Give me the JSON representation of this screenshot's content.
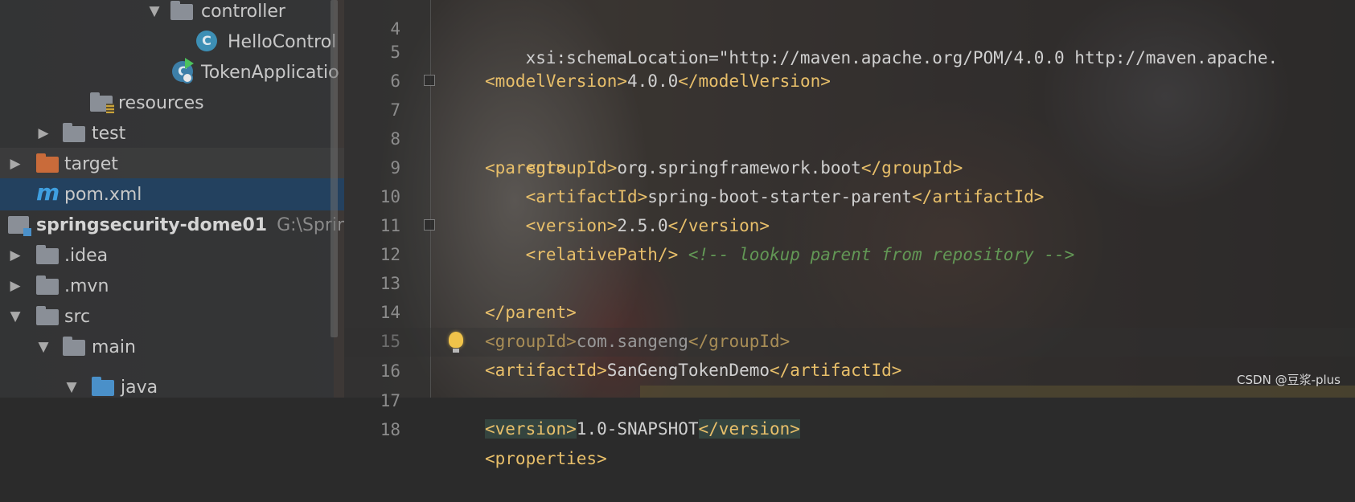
{
  "tree": {
    "controller": "controller",
    "hello_controller": "HelloControl",
    "token_application": "TokenApplicatio",
    "resources": "resources",
    "test": "test",
    "target": "target",
    "pom": "pom.xml",
    "project_name": "springsecurity-dome01",
    "project_path": "G:\\Spring",
    "idea": ".idea",
    "mvn": ".mvn",
    "src": "src",
    "main": "main",
    "java": "java",
    "arrow_expanded": "▼",
    "arrow_collapsed": "▶"
  },
  "editor": {
    "lines": [
      {
        "num": "4",
        "tag_open": "    xsi:schemaLocation=\"http://maven.apache.org/POM/4.0.0 http://maven.apache.",
        "text": "",
        "tag_close": ""
      },
      {
        "num": "5",
        "tag_open": "<modelVersion>",
        "text": "4.0.0",
        "tag_close": "</modelVersion>"
      },
      {
        "num": "6",
        "tag_open": "",
        "text": "",
        "tag_close": ""
      },
      {
        "num": "7",
        "tag_open": "<parent>",
        "text": "",
        "tag_close": ""
      },
      {
        "num": "8",
        "tag_open": "    <groupId>",
        "text": "org.springframework.boot",
        "tag_close": "</groupId>"
      },
      {
        "num": "9",
        "tag_open": "    <artifactId>",
        "text": "spring-boot-starter-parent",
        "tag_close": "</artifactId>"
      },
      {
        "num": "10",
        "tag_open": "    <version>",
        "text": "2.5.0",
        "tag_close": "</version>"
      },
      {
        "num": "11",
        "tag_open": "    <relativePath/>",
        "text": " ",
        "tag_close": "",
        "comment": "<!-- lookup parent from repository -->"
      },
      {
        "num": "12",
        "tag_open": "</parent>",
        "text": "",
        "tag_close": ""
      },
      {
        "num": "13",
        "tag_open": "",
        "text": "",
        "tag_close": ""
      },
      {
        "num": "14",
        "tag_open": "<groupId>",
        "text": "com.sangeng",
        "tag_close": "</groupId>"
      },
      {
        "num": "15",
        "tag_open": "<artifactId>",
        "text": "SanGengTokenDemo",
        "tag_close": "</artifactId>"
      },
      {
        "num": "16",
        "tag_open": "<version>",
        "text": "1.0-SNAPSHOT",
        "tag_close": "</version>"
      },
      {
        "num": "17",
        "tag_open": "",
        "text": "",
        "tag_close": ""
      },
      {
        "num": "18",
        "tag_open": "<properties>",
        "text": "",
        "tag_close": ""
      }
    ]
  },
  "watermark": "CSDN @豆浆-plus",
  "colors": {
    "tag": "#e8bf6a",
    "text": "#d0d0d0",
    "comment": "#629755",
    "selection": "#214264"
  }
}
